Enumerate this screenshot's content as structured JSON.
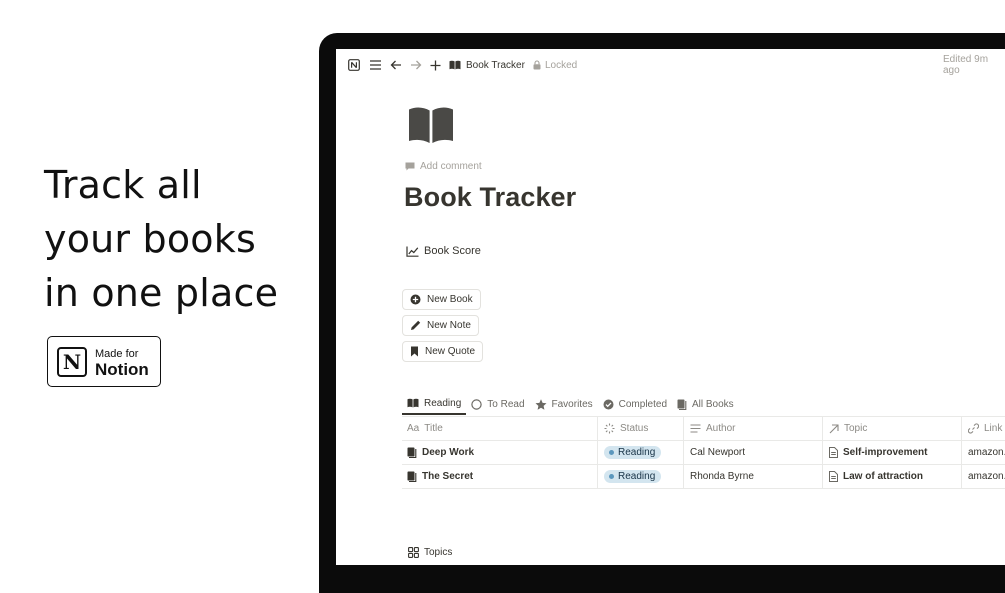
{
  "promo": {
    "headline_lines": [
      "Track all",
      "your books",
      "in one place"
    ],
    "badge": {
      "line1": "Made for",
      "line2": "Notion",
      "logo_letter": "N"
    }
  },
  "topbar": {
    "breadcrumb": "Book Tracker",
    "lock_status": "Locked",
    "edited": "Edited 9m ago"
  },
  "page": {
    "add_comment": "Add comment",
    "title": "Book Tracker",
    "link": "Book Score"
  },
  "buttons": [
    {
      "label": "New Book",
      "icon": "plus-circle-icon"
    },
    {
      "label": "New Note",
      "icon": "pencil-icon"
    },
    {
      "label": "New Quote",
      "icon": "bookmark-icon"
    }
  ],
  "tabs": [
    {
      "label": "Reading",
      "icon": "open-book-icon",
      "active": true
    },
    {
      "label": "To Read",
      "icon": "circle-icon",
      "active": false
    },
    {
      "label": "Favorites",
      "icon": "star-icon",
      "active": false
    },
    {
      "label": "Completed",
      "icon": "check-circle-icon",
      "active": false
    },
    {
      "label": "All Books",
      "icon": "books-icon",
      "active": false
    }
  ],
  "table": {
    "columns": [
      {
        "label": "Title",
        "icon_text": "Aa"
      },
      {
        "label": "Status",
        "icon": "status-icon"
      },
      {
        "label": "Author",
        "icon": "text-lines-icon"
      },
      {
        "label": "Topic",
        "icon": "relation-arrow-icon"
      },
      {
        "label": "Link",
        "icon": "link-icon"
      }
    ],
    "rows": [
      {
        "title": "Deep Work",
        "status": "Reading",
        "author": "Cal Newport",
        "topic": "Self-improvement",
        "link": "amazon.c"
      },
      {
        "title": "The Secret",
        "status": "Reading",
        "author": "Rhonda Byrne",
        "topic": "Law of attraction",
        "link": "amazon.c"
      }
    ]
  },
  "topics": {
    "label": "Topics"
  },
  "colors": {
    "status_pill_bg": "#d3e5ef",
    "status_dot": "#5b97bd",
    "text": "#37352f",
    "muted": "#a5a29c"
  }
}
